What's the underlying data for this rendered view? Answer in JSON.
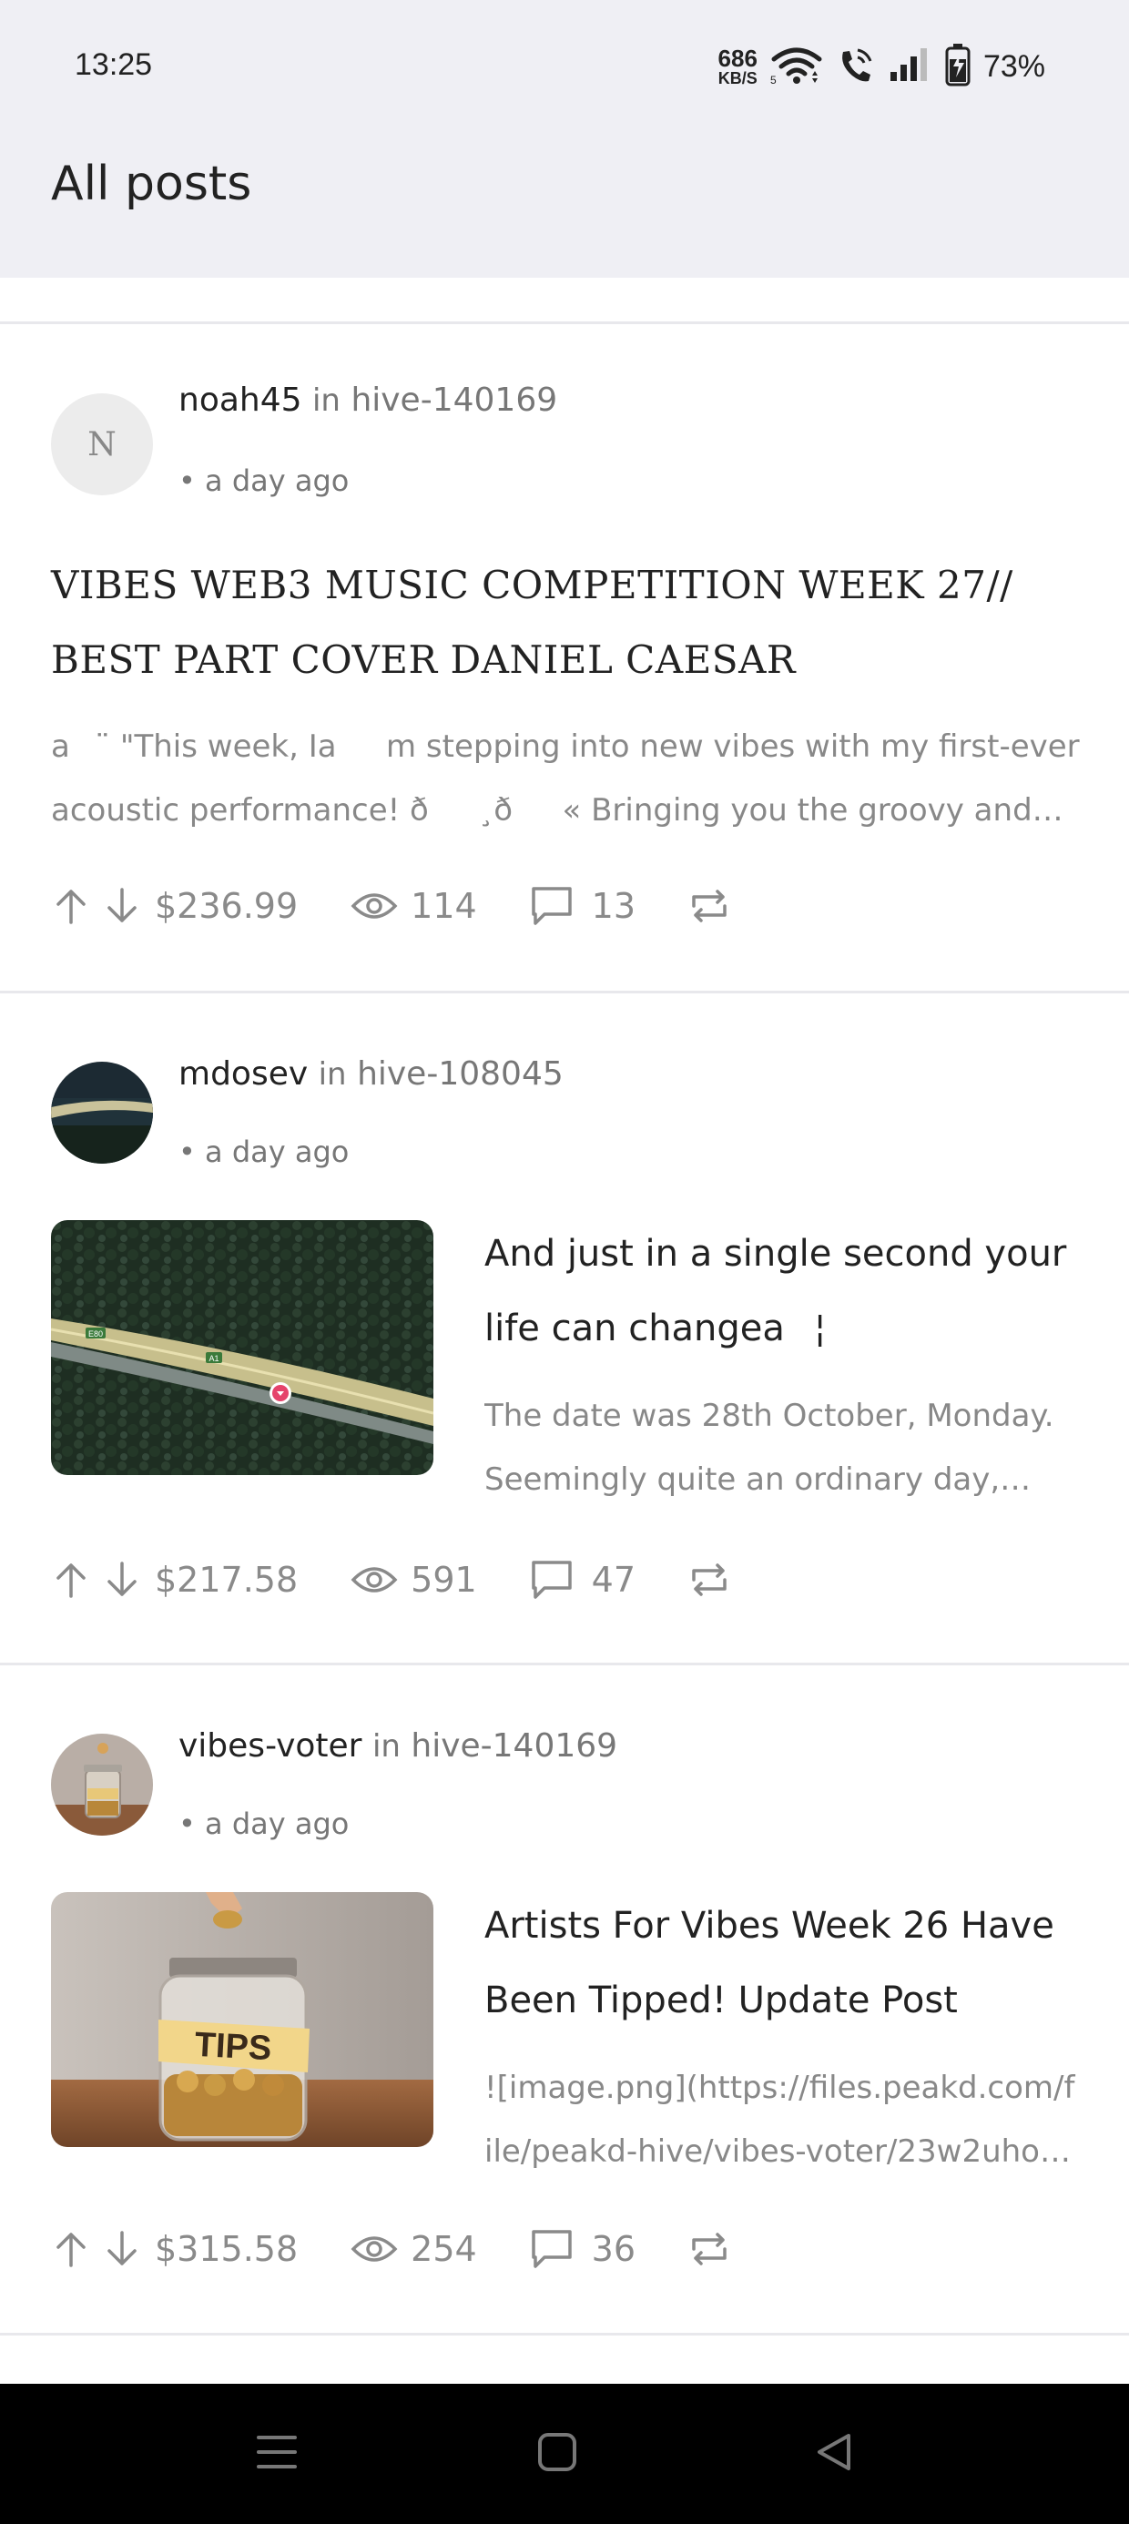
{
  "status_bar": {
    "time": "13:25",
    "net_speed_value": "686",
    "net_speed_unit": "KB/S",
    "battery_percent": "73%",
    "icons": [
      "wifi-icon",
      "wifi-calling-icon",
      "signal-icon",
      "battery-charging-icon"
    ]
  },
  "header": {
    "title": "All posts"
  },
  "posts": [
    {
      "author": "noah45",
      "in_label": "in",
      "community": "hive-140169",
      "time_ago": "• a day ago",
      "avatar_letter": "N",
      "title": "VIBES WEB3 MUSIC COMPETITION WEEK 27// BEST PART COVER DANIEL CAESAR",
      "excerpt": "a¨ \"This week, Iam stepping into new vibes with my first-ever acoustic performance! ð¸ð« Bringing you the groovy and sou...",
      "payout": "$236.99",
      "views": "114",
      "comments": "13"
    },
    {
      "author": "mdosev",
      "in_label": "in",
      "community": "hive-108045",
      "time_ago": "• a day ago",
      "title": "And just in a single second your life can changea¦",
      "excerpt": "The date was 28th October, Monday. Seemingly quite an ordinary day, excep...",
      "map_labels": {
        "road_a": "E80",
        "road_b": "A1"
      },
      "payout": "$217.58",
      "views": "591",
      "comments": "47"
    },
    {
      "author": "vibes-voter",
      "in_label": "in",
      "community": "hive-140169",
      "time_ago": "• a day ago",
      "title": "Artists For Vibes Week 26 Have Been Tipped! Update Post",
      "excerpt": "![image.png](https://files.peakd.com/file/peakd-hive/vibes-voter/23w2uhoJ...",
      "jar_label": "TIPS",
      "payout": "$315.58",
      "views": "254",
      "comments": "36"
    }
  ],
  "colors": {
    "header_bg": "#efeff4",
    "muted": "#8a8a8a",
    "text": "#222222",
    "nav_bg": "#000000"
  }
}
